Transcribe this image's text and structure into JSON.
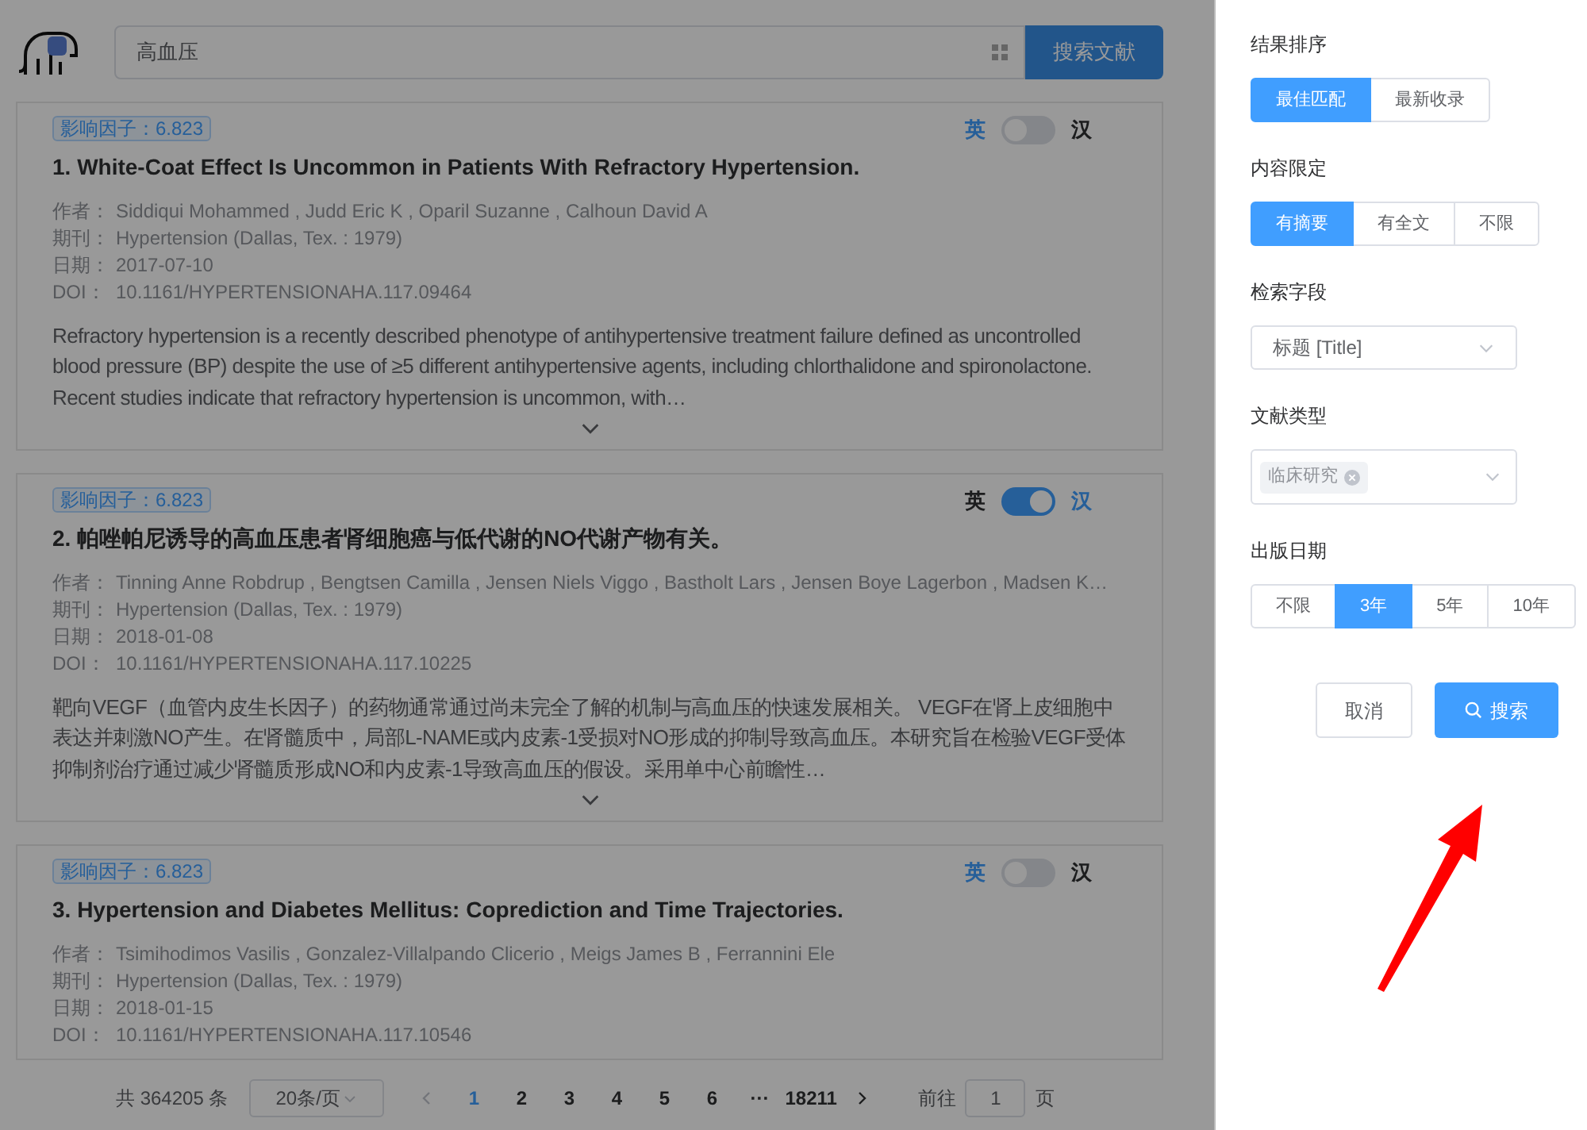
{
  "search": {
    "value": "高血压",
    "button": "搜索文献"
  },
  "results": [
    {
      "impact": "影响因子：6.823",
      "lang_left": "英",
      "lang_right": "汉",
      "chinese": false,
      "title": "1. White-Coat Effect Is Uncommon in Patients With Refractory Hypertension.",
      "meta": [
        {
          "label": "作者：",
          "value": "Siddiqui Mohammed , Judd Eric K , Oparil Suzanne , Calhoun David A"
        },
        {
          "label": "期刊：",
          "value": "Hypertension (Dallas, Tex. : 1979)"
        },
        {
          "label": "日期：",
          "value": "2017-07-10"
        },
        {
          "label": "DOI：",
          "value": "10.1161/HYPERTENSIONAHA.117.09464"
        }
      ],
      "abstract": "Refractory hypertension is a recently described phenotype of antihypertensive treatment failure defined as uncontrolled blood pressure (BP) despite the use of ≥5 different antihypertensive agents, including chlorthalidone and spironolactone. Recent studies indicate that refractory hypertension is uncommon, with…"
    },
    {
      "impact": "影响因子：6.823",
      "lang_left": "英",
      "lang_right": "汉",
      "chinese": true,
      "title": "2. 帕唑帕尼诱导的高血压患者肾细胞癌与低代谢的NO代谢产物有关。",
      "meta": [
        {
          "label": "作者：",
          "value": "Tinning Anne Robdrup , Bengtsen Camilla , Jensen Niels Viggo , Bastholt Lars , Jensen Boye Lagerbon , Madsen K…"
        },
        {
          "label": "期刊：",
          "value": "Hypertension (Dallas, Tex. : 1979)"
        },
        {
          "label": "日期：",
          "value": "2018-01-08"
        },
        {
          "label": "DOI：",
          "value": "10.1161/HYPERTENSIONAHA.117.10225"
        }
      ],
      "abstract": "靶向VEGF（血管内皮生长因子）的药物通常通过尚未完全了解的机制与高血压的快速发展相关。 VEGF在肾上皮细胞中表达并刺激NO产生。在肾髓质中，局部L-NAME或内皮素-1受损对NO形成的抑制导致高血压。本研究旨在检验VEGF受体抑制剂治疗通过减少肾髓质形成NO和内皮素-1导致高血压的假设。采用单中心前瞻性…"
    },
    {
      "impact": "影响因子：6.823",
      "lang_left": "英",
      "lang_right": "汉",
      "chinese": false,
      "title": "3. Hypertension and Diabetes Mellitus: Coprediction and Time Trajectories.",
      "meta": [
        {
          "label": "作者：",
          "value": "Tsimihodimos Vasilis , Gonzalez-Villalpando Clicerio , Meigs James B , Ferrannini Ele"
        },
        {
          "label": "期刊：",
          "value": "Hypertension (Dallas, Tex. : 1979)"
        },
        {
          "label": "日期：",
          "value": "2018-01-15"
        },
        {
          "label": "DOI：",
          "value": "10.1161/HYPERTENSIONAHA.117.10546"
        }
      ]
    }
  ],
  "pagination": {
    "total": "共 364205 条",
    "page_size": "20条/页",
    "pages": [
      {
        "label": "1",
        "selected": true
      },
      {
        "label": "2",
        "selected": false
      },
      {
        "label": "3",
        "selected": false
      },
      {
        "label": "4",
        "selected": false
      },
      {
        "label": "5",
        "selected": false
      },
      {
        "label": "6",
        "selected": false
      },
      {
        "label": "···",
        "selected": false
      },
      {
        "label": "18211",
        "selected": false
      }
    ],
    "goto_label": "前往",
    "goto_value": "1",
    "goto_unit": "页"
  },
  "drawer": {
    "groups": [
      {
        "kind": "buttons",
        "title": "结果排序",
        "options": [
          {
            "label": "最佳匹配",
            "selected": true
          },
          {
            "label": "最新收录",
            "selected": false
          }
        ]
      },
      {
        "kind": "buttons",
        "title": "内容限定",
        "options": [
          {
            "label": "有摘要",
            "selected": true
          },
          {
            "label": "有全文",
            "selected": false
          },
          {
            "label": "不限",
            "selected": false
          }
        ]
      },
      {
        "kind": "select",
        "title": "检索字段",
        "value": "标题 [Title]"
      },
      {
        "kind": "tags",
        "title": "文献类型",
        "tags": [
          "临床研究"
        ]
      },
      {
        "kind": "buttons",
        "title": "出版日期",
        "options": [
          {
            "label": "不限",
            "selected": false
          },
          {
            "label": "3年",
            "selected": true
          },
          {
            "label": "5年",
            "selected": false
          },
          {
            "label": "10年",
            "selected": false
          }
        ]
      }
    ],
    "cancel": "取消",
    "submit": "搜索"
  }
}
